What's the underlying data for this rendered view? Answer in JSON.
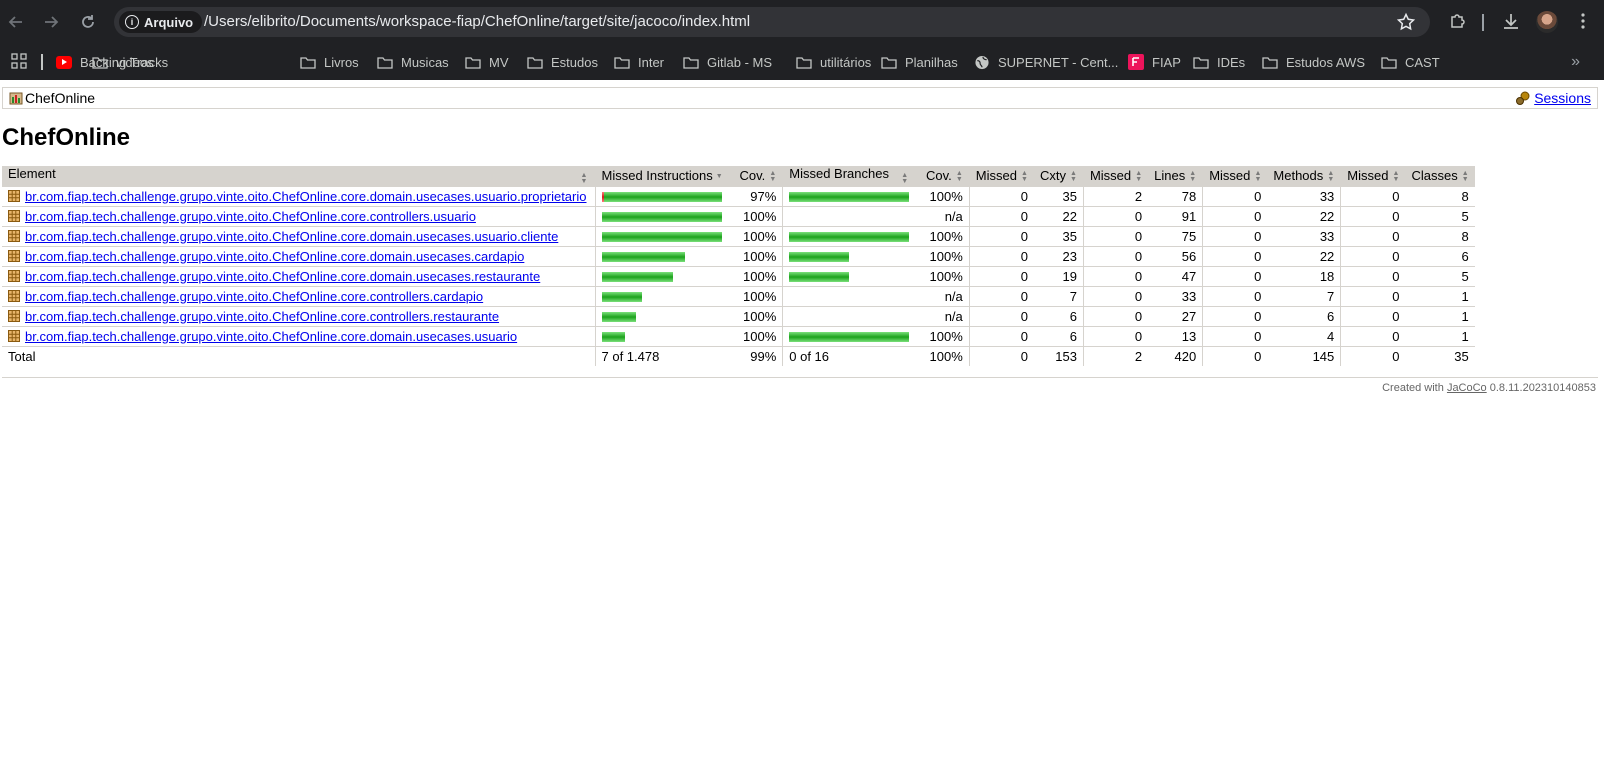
{
  "browser": {
    "chip_label": "Arquivo",
    "url": "/Users/elibrito/Documents/workspace-fiap/ChefOnline/target/site/jacoco/index.html"
  },
  "bookmarks": [
    {
      "label": "Backing Tracks",
      "icon": "youtube-icon"
    },
    {
      "label": "videos",
      "icon": "folder-icon"
    },
    {
      "label": "Livros",
      "icon": "folder-icon"
    },
    {
      "label": "Musicas",
      "icon": "folder-icon"
    },
    {
      "label": "MV",
      "icon": "folder-icon"
    },
    {
      "label": "Estudos",
      "icon": "folder-icon"
    },
    {
      "label": "Inter",
      "icon": "folder-icon"
    },
    {
      "label": "Gitlab - MS",
      "icon": "folder-icon"
    },
    {
      "label": "utilitários",
      "icon": "folder-icon"
    },
    {
      "label": "Planilhas",
      "icon": "folder-icon"
    },
    {
      "label": "SUPERNET - Cent...",
      "icon": "globe-icon"
    },
    {
      "label": "FIAP",
      "icon": "fiap-icon"
    },
    {
      "label": "IDEs",
      "icon": "folder-icon"
    },
    {
      "label": "Estudos AWS",
      "icon": "folder-icon"
    },
    {
      "label": "CAST",
      "icon": "folder-icon"
    }
  ],
  "page": {
    "breadcrumb": "ChefOnline",
    "sessions_label": "Sessions",
    "title": "ChefOnline",
    "footer_prefix": "Created with",
    "footer_link": "JaCoCo",
    "footer_version": "0.8.11.202310140853"
  },
  "table": {
    "headers": {
      "element": "Element",
      "missed_instructions": "Missed Instructions",
      "cov1": "Cov.",
      "missed_branches": "Missed Branches",
      "cov2": "Cov.",
      "missed_cxty": "Missed",
      "cxty": "Cxty",
      "missed_lines": "Missed",
      "lines": "Lines",
      "missed_methods": "Missed",
      "methods": "Methods",
      "missed_classes": "Missed",
      "classes": "Classes"
    },
    "rows": [
      {
        "element": "br.com.fiap.tech.challenge.grupo.vinte.oito.ChefOnline.core.domain.usecases.usuario.proprietario",
        "instr_missed_frac": 0.02,
        "instr_covered_frac": 0.98,
        "cov": "97%",
        "branch_missed_frac": 0,
        "branch_covered_frac": 1.0,
        "bcov": "100%",
        "missed_cxty": "0",
        "cxty": "35",
        "missed_lines": "2",
        "lines": "78",
        "missed_methods": "0",
        "methods": "33",
        "missed_classes": "0",
        "classes": "8"
      },
      {
        "element": "br.com.fiap.tech.challenge.grupo.vinte.oito.ChefOnline.core.controllers.usuario",
        "instr_missed_frac": 0,
        "instr_covered_frac": 1.0,
        "cov": "100%",
        "branch_missed_frac": 0,
        "branch_covered_frac": 0,
        "bcov": "n/a",
        "missed_cxty": "0",
        "cxty": "22",
        "missed_lines": "0",
        "lines": "91",
        "missed_methods": "0",
        "methods": "22",
        "missed_classes": "0",
        "classes": "5"
      },
      {
        "element": "br.com.fiap.tech.challenge.grupo.vinte.oito.ChefOnline.core.domain.usecases.usuario.cliente",
        "instr_missed_frac": 0,
        "instr_covered_frac": 1.0,
        "cov": "100%",
        "branch_missed_frac": 0,
        "branch_covered_frac": 1.0,
        "bcov": "100%",
        "missed_cxty": "0",
        "cxty": "35",
        "missed_lines": "0",
        "lines": "75",
        "missed_methods": "0",
        "methods": "33",
        "missed_classes": "0",
        "classes": "8"
      },
      {
        "element": "br.com.fiap.tech.challenge.grupo.vinte.oito.ChefOnline.core.domain.usecases.cardapio",
        "instr_missed_frac": 0,
        "instr_covered_frac": 0.69,
        "cov": "100%",
        "branch_missed_frac": 0,
        "branch_covered_frac": 0.5,
        "bcov": "100%",
        "missed_cxty": "0",
        "cxty": "23",
        "missed_lines": "0",
        "lines": "56",
        "missed_methods": "0",
        "methods": "22",
        "missed_classes": "0",
        "classes": "6"
      },
      {
        "element": "br.com.fiap.tech.challenge.grupo.vinte.oito.ChefOnline.core.domain.usecases.restaurante",
        "instr_missed_frac": 0,
        "instr_covered_frac": 0.59,
        "cov": "100%",
        "branch_missed_frac": 0,
        "branch_covered_frac": 0.5,
        "bcov": "100%",
        "missed_cxty": "0",
        "cxty": "19",
        "missed_lines": "0",
        "lines": "47",
        "missed_methods": "0",
        "methods": "18",
        "missed_classes": "0",
        "classes": "5"
      },
      {
        "element": "br.com.fiap.tech.challenge.grupo.vinte.oito.ChefOnline.core.controllers.cardapio",
        "instr_missed_frac": 0,
        "instr_covered_frac": 0.33,
        "cov": "100%",
        "branch_missed_frac": 0,
        "branch_covered_frac": 0,
        "bcov": "n/a",
        "missed_cxty": "0",
        "cxty": "7",
        "missed_lines": "0",
        "lines": "33",
        "missed_methods": "0",
        "methods": "7",
        "missed_classes": "0",
        "classes": "1"
      },
      {
        "element": "br.com.fiap.tech.challenge.grupo.vinte.oito.ChefOnline.core.controllers.restaurante",
        "instr_missed_frac": 0,
        "instr_covered_frac": 0.28,
        "cov": "100%",
        "branch_missed_frac": 0,
        "branch_covered_frac": 0,
        "bcov": "n/a",
        "missed_cxty": "0",
        "cxty": "6",
        "missed_lines": "0",
        "lines": "27",
        "missed_methods": "0",
        "methods": "6",
        "missed_classes": "0",
        "classes": "1"
      },
      {
        "element": "br.com.fiap.tech.challenge.grupo.vinte.oito.ChefOnline.core.domain.usecases.usuario",
        "instr_missed_frac": 0,
        "instr_covered_frac": 0.19,
        "cov": "100%",
        "branch_missed_frac": 0,
        "branch_covered_frac": 1.0,
        "bcov": "100%",
        "missed_cxty": "0",
        "cxty": "6",
        "missed_lines": "0",
        "lines": "13",
        "missed_methods": "0",
        "methods": "4",
        "missed_classes": "0",
        "classes": "1"
      }
    ],
    "total": {
      "label": "Total",
      "instructions": "7 of 1.478",
      "cov": "99%",
      "branches": "0 of 16",
      "bcov": "100%",
      "missed_cxty": "0",
      "cxty": "153",
      "missed_lines": "2",
      "lines": "420",
      "missed_methods": "0",
      "methods": "145",
      "missed_classes": "0",
      "classes": "35"
    }
  }
}
